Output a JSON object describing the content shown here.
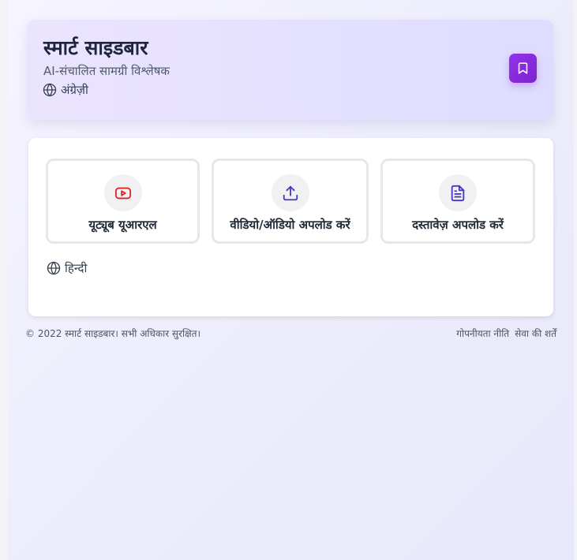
{
  "header": {
    "title": "स्मार्ट साइडबार",
    "subtitle": "AI-संचालित सामग्री विश्लेषक",
    "language_label": "अंग्रेज़ी",
    "bookmark_icon": "bookmark-icon",
    "accent_color": "#8b2fe0"
  },
  "main": {
    "options": [
      {
        "label": "यूट्यूब यूआरएल",
        "icon": "youtube-icon",
        "icon_color": "#dc2626"
      },
      {
        "label": "वीडियो/ऑडियो अपलोड करें",
        "icon": "upload-icon",
        "icon_color": "#4338ca"
      },
      {
        "label": "दस्तावेज़ अपलोड करें",
        "icon": "document-icon",
        "icon_color": "#4338ca"
      }
    ],
    "language_label": "हिन्दी"
  },
  "footer": {
    "copyright": "© 2022 स्मार्ट साइडबार। सभी अधिकार सुरक्षित।",
    "privacy_link": "गोपनीयता नीति",
    "terms_link": "सेवा की शर्तें"
  }
}
